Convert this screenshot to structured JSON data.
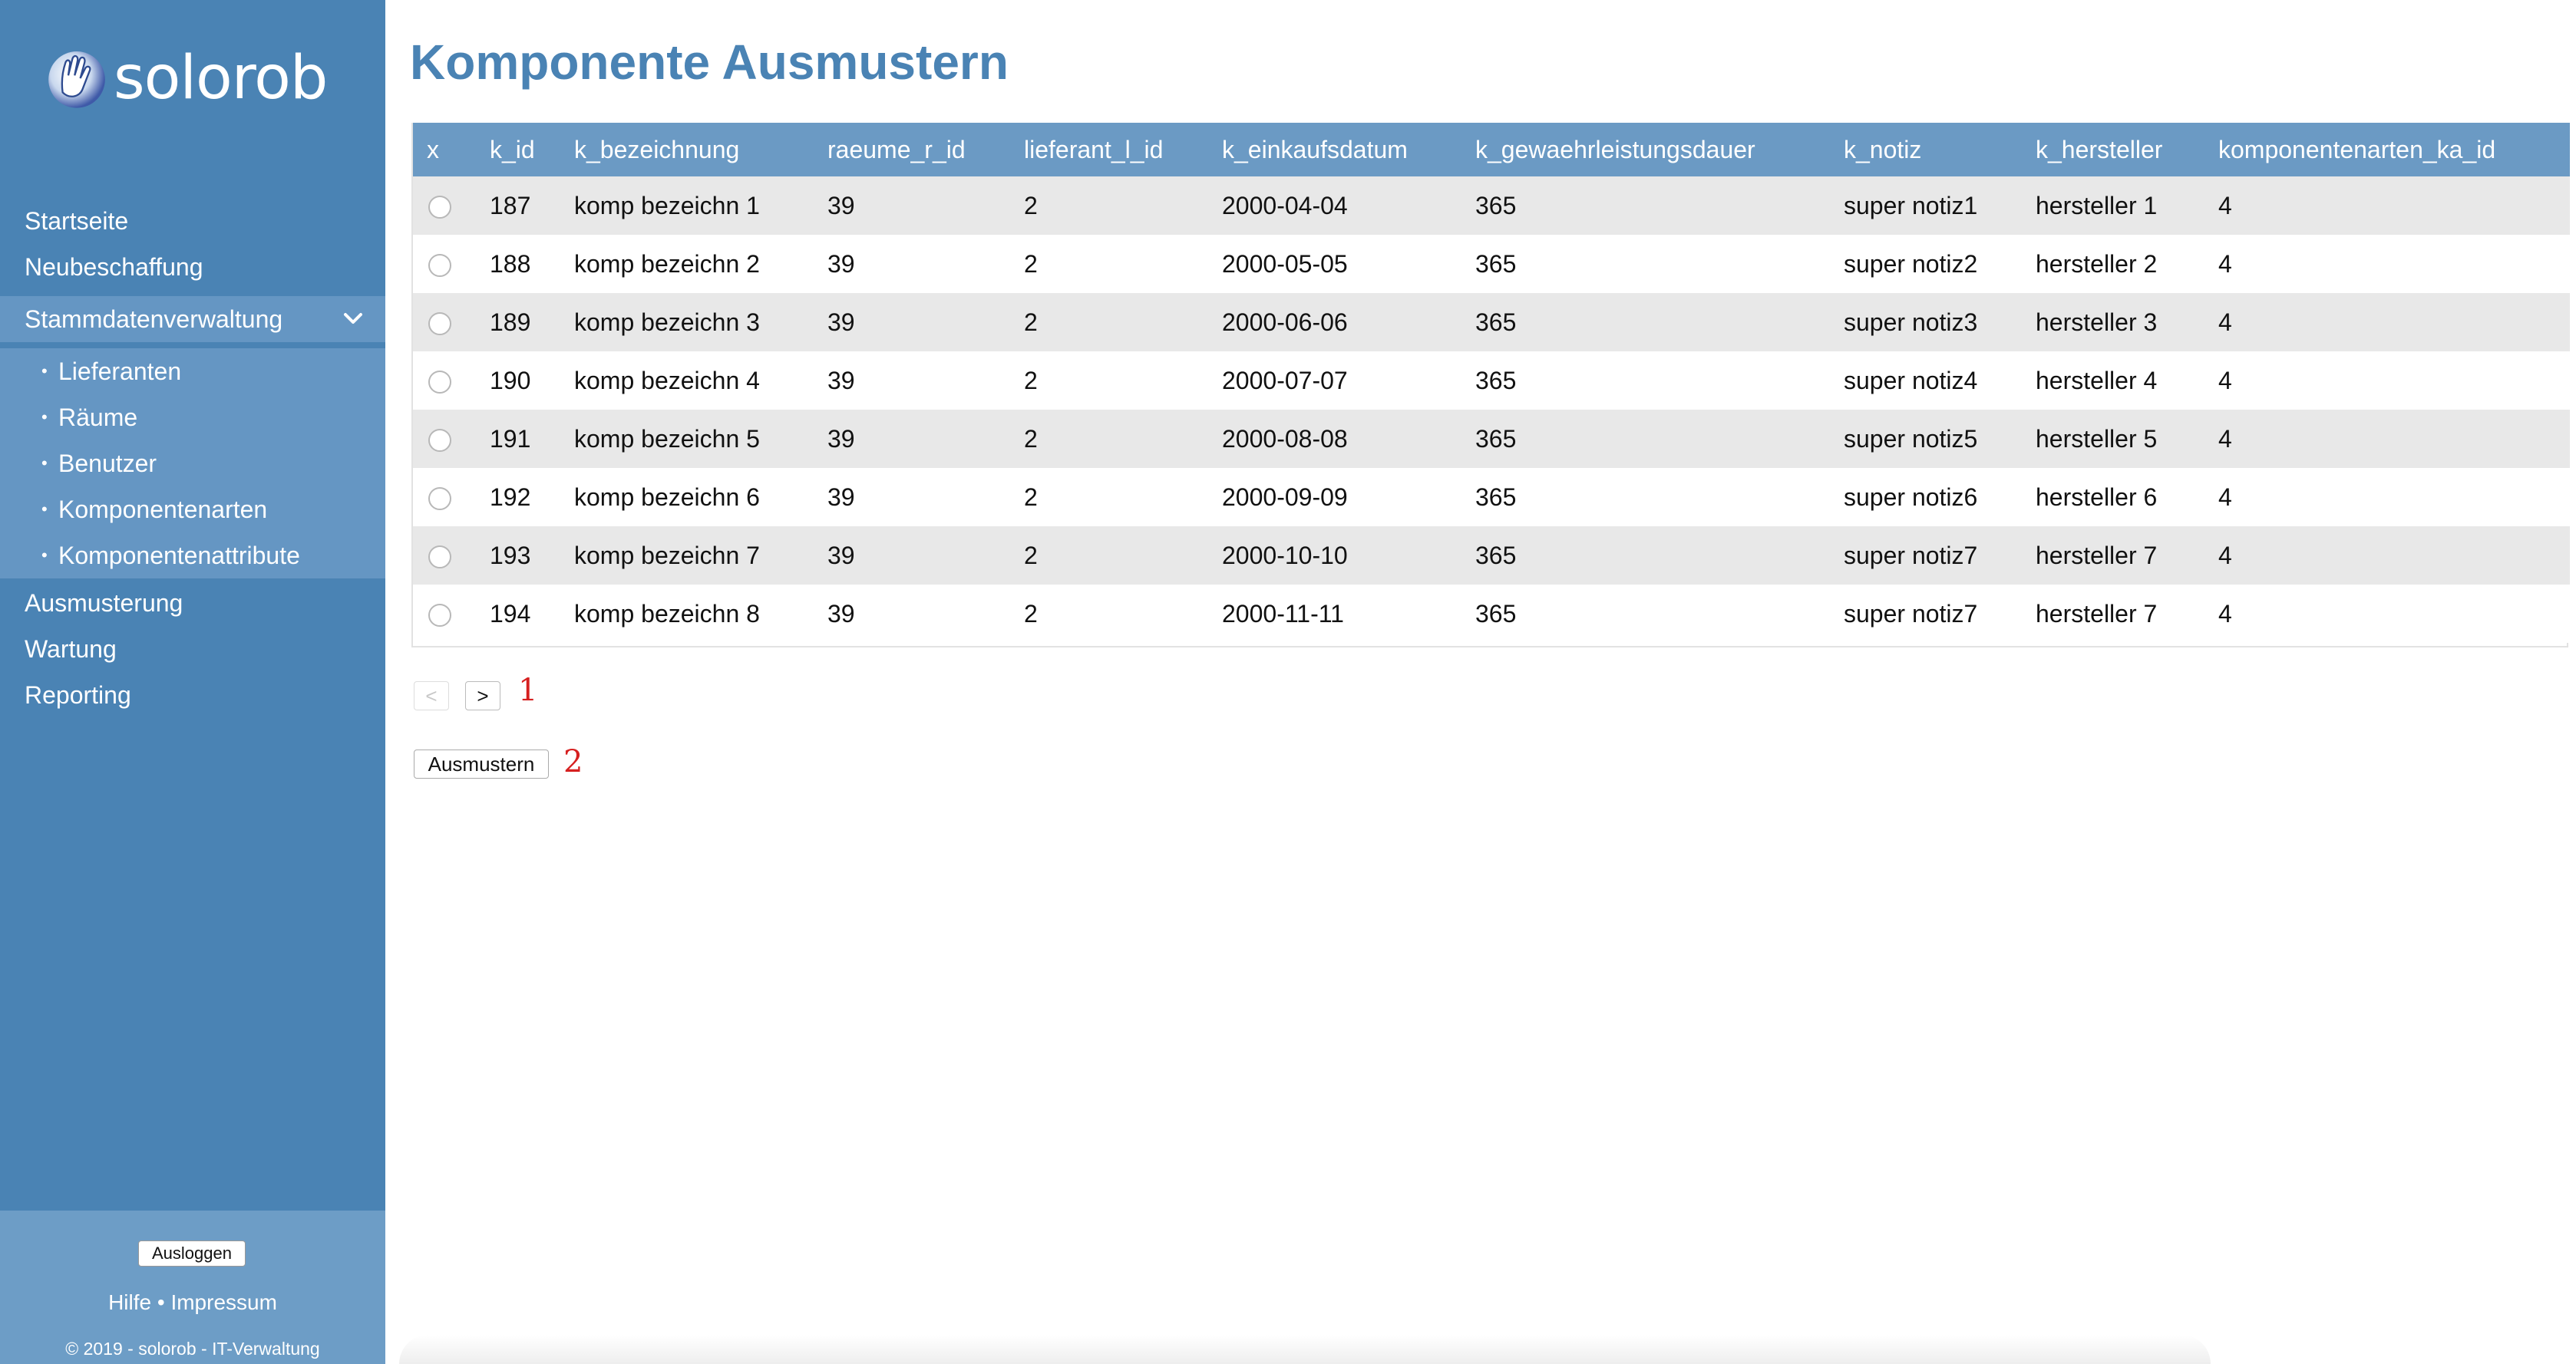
{
  "brand": {
    "name": "solorob"
  },
  "sidebar": {
    "items": [
      {
        "label": "Startseite"
      },
      {
        "label": "Neubeschaffung"
      },
      {
        "label": "Stammdatenverwaltung"
      },
      {
        "label": "Ausmusterung"
      },
      {
        "label": "Wartung"
      },
      {
        "label": "Reporting"
      }
    ],
    "subitems": [
      {
        "label": "Lieferanten"
      },
      {
        "label": "Räume"
      },
      {
        "label": "Benutzer"
      },
      {
        "label": "Komponentenarten"
      },
      {
        "label": "Komponentenattribute"
      }
    ],
    "bullet": "•",
    "logout_label": "Ausloggen",
    "footer": {
      "help": "Hilfe",
      "separator": "•",
      "imprint": "Impressum",
      "copyright": "© 2019 - solorob - IT-Verwaltung"
    }
  },
  "page": {
    "title": "Komponente Ausmustern"
  },
  "table": {
    "headers": [
      "x",
      "k_id",
      "k_bezeichnung",
      "raeume_r_id",
      "lieferant_l_id",
      "k_einkaufsdatum",
      "k_gewaehrleistungsdauer",
      "k_notiz",
      "k_hersteller",
      "komponentenarten_ka_id"
    ],
    "rows": [
      [
        "187",
        "komp bezeichn 1",
        "39",
        "2",
        "2000-04-04",
        "365",
        "super notiz1",
        "hersteller 1",
        "4"
      ],
      [
        "188",
        "komp bezeichn 2",
        "39",
        "2",
        "2000-05-05",
        "365",
        "super notiz2",
        "hersteller 2",
        "4"
      ],
      [
        "189",
        "komp bezeichn 3",
        "39",
        "2",
        "2000-06-06",
        "365",
        "super notiz3",
        "hersteller 3",
        "4"
      ],
      [
        "190",
        "komp bezeichn 4",
        "39",
        "2",
        "2000-07-07",
        "365",
        "super notiz4",
        "hersteller 4",
        "4"
      ],
      [
        "191",
        "komp bezeichn 5",
        "39",
        "2",
        "2000-08-08",
        "365",
        "super notiz5",
        "hersteller 5",
        "4"
      ],
      [
        "192",
        "komp bezeichn 6",
        "39",
        "2",
        "2000-09-09",
        "365",
        "super notiz6",
        "hersteller 6",
        "4"
      ],
      [
        "193",
        "komp bezeichn 7",
        "39",
        "2",
        "2000-10-10",
        "365",
        "super notiz7",
        "hersteller 7",
        "4"
      ],
      [
        "194",
        "komp bezeichn 8",
        "39",
        "2",
        "2000-11-11",
        "365",
        "super notiz7",
        "hersteller 7",
        "4"
      ]
    ]
  },
  "pager": {
    "prev_label": "<",
    "next_label": ">"
  },
  "actions": {
    "retire_label": "Ausmustern"
  },
  "markers": {
    "one": "1",
    "two": "2"
  },
  "colors": {
    "sidebar_bg": "#4a83b4",
    "sidebar_active": "#6596c3",
    "table_header": "#6b9ac4",
    "title": "#4a83b4",
    "marker": "#d62020"
  }
}
